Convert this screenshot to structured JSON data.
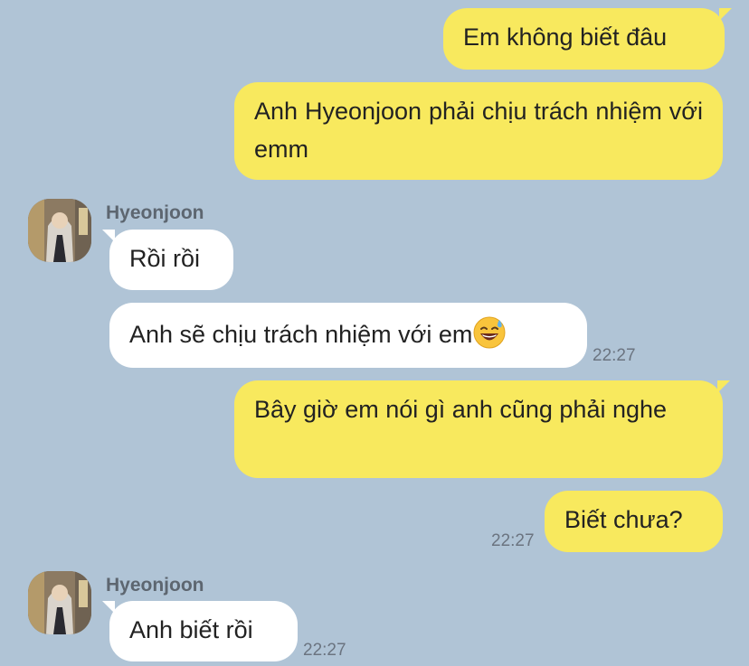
{
  "messages": [
    {
      "text": "Em không biết đâu"
    },
    {
      "text": "Anh Hyeonjoon phải chịu trách nhiệm với emm"
    },
    {
      "sender": "Hyeonjoon",
      "text": "Rồi rồi"
    },
    {
      "text": "Anh sẽ chịu trách nhiệm với em",
      "emoji": "grinning-sweat-emoji",
      "time": "22:27"
    },
    {
      "text": "Bây giờ em nói gì anh cũng phải nghe"
    },
    {
      "text": "Biết chưa?",
      "time": "22:27"
    },
    {
      "sender": "Hyeonjoon",
      "text": "Anh biết rồi",
      "time": "22:27"
    }
  ],
  "colors": {
    "background": "#b0c4d6",
    "outgoing_bubble": "#f8e95e",
    "incoming_bubble": "#ffffff",
    "timestamp": "#6b7480",
    "sender_name": "#5d6670"
  }
}
